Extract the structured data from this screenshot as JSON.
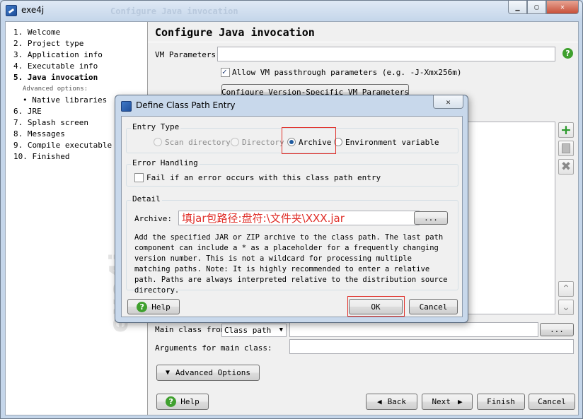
{
  "window": {
    "title": "exe4j",
    "ghost_title": "Configure Java invocation",
    "minimize": "▁",
    "maximize": "▢",
    "close": "✕"
  },
  "sidebar": {
    "steps": [
      {
        "label": "1.  Welcome"
      },
      {
        "label": "2.  Project type"
      },
      {
        "label": "3.  Application info"
      },
      {
        "label": "4.  Executable info"
      },
      {
        "label": "5.  Java invocation",
        "current": true
      },
      {
        "label": "Advanced options:",
        "heading": true
      },
      {
        "label": "• Native libraries",
        "sub": true
      },
      {
        "label": "6.  JRE"
      },
      {
        "label": "7.  Splash screen"
      },
      {
        "label": "8.  Messages"
      },
      {
        "label": "9.  Compile executable"
      },
      {
        "label": "10.  Finished"
      }
    ],
    "watermark": "exe4j"
  },
  "main": {
    "title": "Configure Java invocation",
    "vm_label": "VM Parameters:",
    "vm_value": "",
    "passthrough_label": "Allow VM passthrough parameters (e.g. -J-Xmx256m)",
    "passthrough_checked": true,
    "config_button": "Configure Version-Specific VM Parameters",
    "main_class_label": "Main class from",
    "main_class_source": "Class path",
    "main_class_value": "",
    "browse_label": "...",
    "args_label": "Arguments for main class:",
    "args_value": "",
    "advanced_button": "Advanced Options"
  },
  "footer": {
    "help": "Help",
    "back": "Back",
    "next": "Next",
    "finish": "Finish",
    "cancel": "Cancel"
  },
  "dialog": {
    "title": "Define Class Path Entry",
    "close": "✕",
    "entry_type": {
      "label": "Entry Type",
      "options": [
        "Scan directory",
        "Directory",
        "Archive",
        "Environment variable"
      ],
      "selected": "Archive"
    },
    "error_handling": {
      "label": "Error Handling",
      "checkbox_label": "Fail if an error occurs with this class path entry",
      "checked": false
    },
    "detail": {
      "label": "Detail",
      "archive_label": "Archive:",
      "archive_value": "填jar包路径:盘符:\\文件夹\\XXX.jar",
      "browse": "...",
      "description": "Add the specified JAR or ZIP archive to the class path. The last path component can include a * as a placeholder for a frequently changing version number. This is not a wildcard for processing multiple matching paths. Note: It is highly recommended to enter a relative path. Paths are always interpreted relative to the distribution source directory."
    },
    "help": "Help",
    "ok": "OK",
    "cancel": "Cancel"
  }
}
